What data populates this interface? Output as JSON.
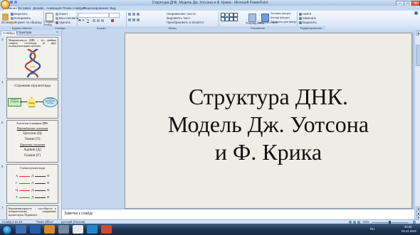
{
  "window": {
    "title": "Структура ДНК. Модель Дж. Уотсона и Ф. Крика - Microsoft PowerPoint",
    "min": "–",
    "max": "□",
    "close": "✕"
  },
  "ribbon": {
    "tabs": [
      "Главная",
      "Вставка",
      "Дизайн",
      "Анимация",
      "Показ слайдов",
      "Рецензирование",
      "Вид"
    ],
    "clipboard": {
      "paste": "Вставить",
      "cut": "Вырезать",
      "copy": "Копировать",
      "format_painter": "Формат по образцу",
      "label": "Буфер обмена"
    },
    "slides": {
      "new_slide": "Создать слайд",
      "layout": "Макет",
      "reset": "Восстановить",
      "delete": "Удалить",
      "label": "Слайды"
    },
    "font": {
      "name": "",
      "size": "",
      "label": "Шрифт"
    },
    "paragraph": {
      "direction": "Направление текста",
      "align": "Выровнять текст",
      "smartart": "Преобразовать в SmartArt",
      "label": "Абзац"
    },
    "drawing": {
      "arrange": "Упорядочить",
      "quick_styles": "Экспресс-стили",
      "fill": "Заливка фигуры",
      "outline": "Контур фигуры",
      "effects": "Эффекты для фигур",
      "label": "Рисование"
    },
    "editing": {
      "find": "Найти",
      "replace": "Заменить",
      "select": "Выделить",
      "label": "Редактирование"
    }
  },
  "pane": {
    "tabs": [
      "Слайды",
      "Структура"
    ],
    "slides": [
      {
        "num": "3",
        "text": "Макромолекула ДНК – это двойная спираль, состоящая из двух полинуклеотидных цепочек."
      },
      {
        "num": "4",
        "title": "Строение нуклеотида",
        "left": "Азотистое основание",
        "mid": "Сахар",
        "right": "Остаток фосфорной кислоты"
      },
      {
        "num": "5",
        "lines": [
          "Азотистые основания ДНК:",
          "Пиримидиновые основания",
          "Цитозин (Ц)",
          "Тимин (Т)",
          "Пуриновые основания",
          "Аденин (А)",
          "Гуанин (Г)"
        ]
      },
      {
        "num": "6",
        "title": "Схема нуклеотида",
        "rows": [
          [
            "А",
            "Д",
            "Ф"
          ],
          [
            "Г",
            "Д",
            "Ф"
          ],
          [
            "Ц",
            "Д",
            "Ф"
          ],
          [
            "Т",
            "Д",
            "Ф"
          ]
        ]
      },
      {
        "num": "7",
        "text": "Комплементарность – способность к избирательному соединению нуклеотидов. Пуриновое"
      }
    ]
  },
  "slide": {
    "title_line1": "Структура ДНК.",
    "title_line2": "Модель Дж. Уотсона",
    "title_line3": "и Ф. Крика"
  },
  "notes": {
    "placeholder": "Заметки к слайду"
  },
  "status": {
    "slide_of": "Слайд 2 из 23",
    "theme": "\"Тема Office\"",
    "language": "русский (Россия)",
    "zoom": "63%"
  },
  "taskbar": {
    "lang": "RU",
    "time": "20:26",
    "date": "09.12.2020"
  },
  "colors": {
    "start_orb": "#1f7cc7",
    "chrome_blue": "#c5d6ec"
  }
}
